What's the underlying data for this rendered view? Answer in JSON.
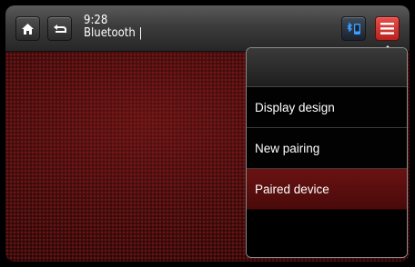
{
  "status": {
    "time": "9:28",
    "source": "Bluetooth |"
  },
  "topbar": {
    "home_icon": "home-icon",
    "back_icon": "back-arrow-icon",
    "bluetooth_icon": "bluetooth-phone-icon",
    "menu_icon": "hamburger-menu-icon",
    "menu_color": "#d93a35"
  },
  "menu": {
    "items": [
      {
        "label": "Display design",
        "selected": false
      },
      {
        "label": "New pairing",
        "selected": false
      },
      {
        "label": "Paired device",
        "selected": true
      }
    ],
    "selected_color": "#5a0e0e"
  }
}
